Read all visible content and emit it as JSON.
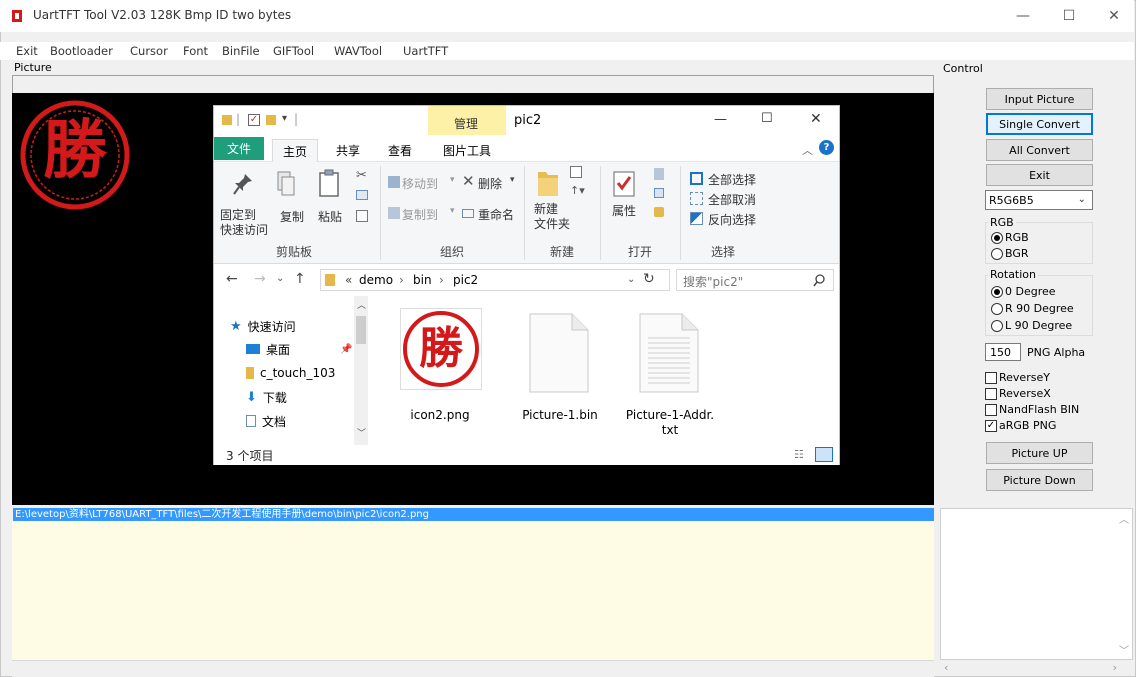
{
  "window": {
    "title": "UartTFT Tool V2.03  128K  Bmp ID two bytes",
    "minimize": "—",
    "maximize": "☐",
    "close": "✕"
  },
  "menu": [
    "Exit",
    "Bootloader",
    "Cursor",
    "Font",
    "BinFile",
    "GIFTool",
    "WAVTool",
    "UartTFT"
  ],
  "picture_group": "Picture",
  "control_group": "Control",
  "seal_char": "勝",
  "explorer": {
    "title": "pic2",
    "manage_tab": "管理",
    "minimize": "—",
    "maximize": "☐",
    "close": "✕",
    "tabs": [
      "文件",
      "主页",
      "共享",
      "查看",
      "图片工具"
    ],
    "ribbon": {
      "pin": "固定到\n快速访问",
      "copy": "复制",
      "paste": "粘贴",
      "clipboard": "剪贴板",
      "move_to": "移动到",
      "copy_to": "复制到",
      "delete": "删除",
      "rename": "重命名",
      "organize": "组织",
      "new_folder": "新建\n文件夹",
      "new": "新建",
      "properties": "属性",
      "open": "打开",
      "select_all": "全部选择",
      "select_none": "全部取消",
      "invert": "反向选择",
      "select": "选择"
    },
    "address": {
      "prefix": "«",
      "path": [
        "demo",
        "bin",
        "pic2"
      ],
      "search_placeholder": "搜索\"pic2\""
    },
    "nav": [
      {
        "label": "快速访问",
        "icon": "star-icon"
      },
      {
        "label": "桌面",
        "icon": "desktop-icon"
      },
      {
        "label": "c_touch_103",
        "icon": "folder-icon"
      },
      {
        "label": "下载",
        "icon": "download-icon"
      },
      {
        "label": "文档",
        "icon": "document-icon"
      }
    ],
    "files": [
      {
        "name": "icon2.png",
        "type": "image"
      },
      {
        "name": "Picture-1.bin",
        "type": "bin"
      },
      {
        "name": "Picture-1-Addr.\ntxt",
        "type": "txt"
      }
    ],
    "status": "3 个项目"
  },
  "path_line": "E:\\levetop\\资料\\LT768\\UART_TFT\\files\\二次开发工程使用手册\\demo\\bin\\pic2\\icon2.png",
  "controls": {
    "input_picture": "Input Picture",
    "single_convert": "Single Convert",
    "all_convert": "All Convert",
    "exit": "Exit",
    "format": "R5G6B5",
    "rgb_group": "RGB",
    "rgb_options": [
      "RGB",
      "BGR"
    ],
    "rotation_group": "Rotation",
    "rotation_options": [
      "0 Degree",
      "R 90 Degree",
      "L 90 Degree"
    ],
    "alpha_value": "150",
    "alpha_label": "PNG  Alpha",
    "checks": [
      {
        "label": "ReverseY",
        "checked": false
      },
      {
        "label": "ReverseX",
        "checked": false
      },
      {
        "label": "NandFlash BIN",
        "checked": false
      },
      {
        "label": "aRGB PNG",
        "checked": true
      }
    ],
    "picture_up": "Picture UP",
    "picture_down": "Picture Down"
  },
  "colors": {
    "seal_red": "#d4191b",
    "accent_blue": "#3399ff",
    "log_bg": "#fffce6"
  }
}
